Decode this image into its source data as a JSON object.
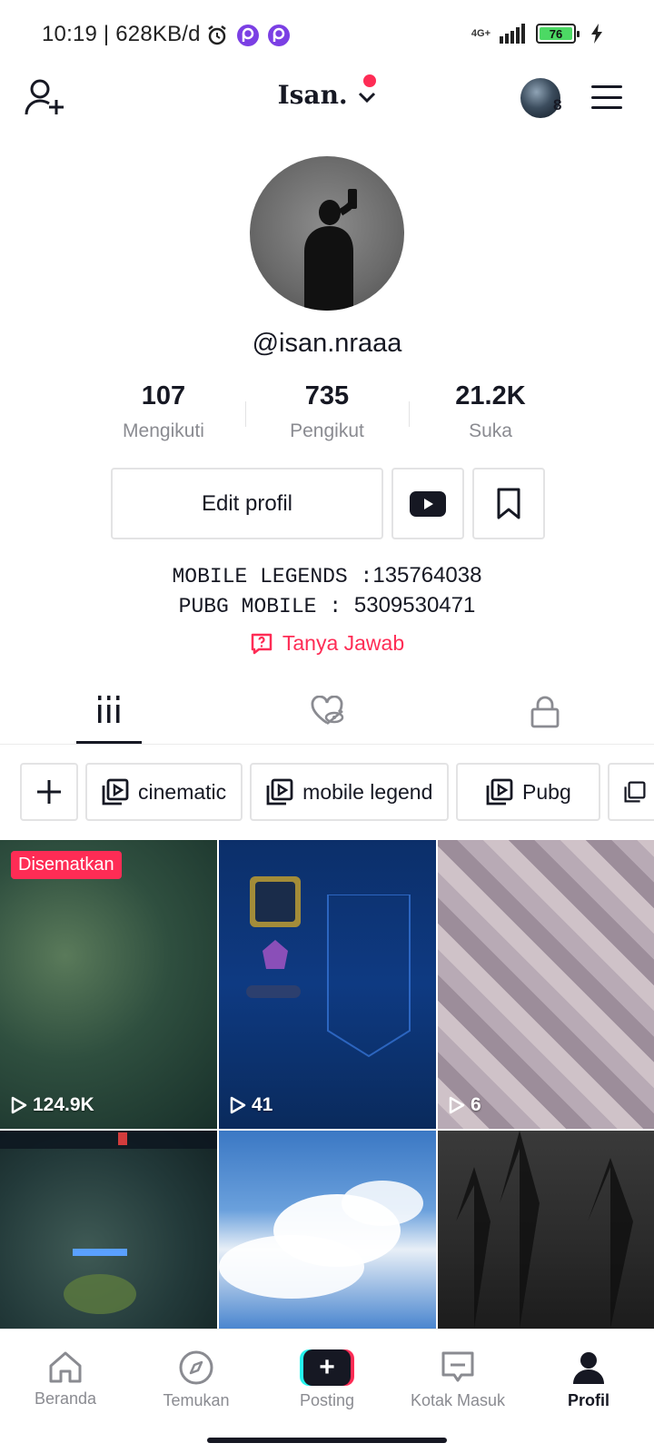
{
  "status_bar": {
    "time": "10:19 | 628KB/d",
    "network": "4G+",
    "battery": "76"
  },
  "header": {
    "username": "Isan.",
    "friends_count": "8"
  },
  "profile": {
    "handle": "@isan.nraaa",
    "stats": [
      {
        "value": "107",
        "label": "Mengikuti"
      },
      {
        "value": "735",
        "label": "Pengikut"
      },
      {
        "value": "21.2K",
        "label": "Suka"
      }
    ],
    "edit_label": "Edit profil",
    "bio_line1_text": "MOBILE LEGENDS :",
    "bio_line1_num": "135764038",
    "bio_line2_text": "PUBG MOBILE : ",
    "bio_line2_num": "5309530471",
    "qa_label": "Tanya Jawab"
  },
  "playlists": [
    "cinematic",
    "mobile legend",
    "Pubg"
  ],
  "videos": [
    {
      "views": "124.9K",
      "pinned_label": "Disematkan"
    },
    {
      "views": "41"
    },
    {
      "views": "6"
    },
    {
      "views": ""
    },
    {
      "views": ""
    },
    {
      "views": ""
    }
  ],
  "bottom_nav": [
    {
      "label": "Beranda"
    },
    {
      "label": "Temukan"
    },
    {
      "label": "Posting"
    },
    {
      "label": "Kotak Masuk"
    },
    {
      "label": "Profil"
    }
  ],
  "colors": {
    "accent": "#fe2c55",
    "text": "#161823",
    "muted": "#8a8b91"
  }
}
